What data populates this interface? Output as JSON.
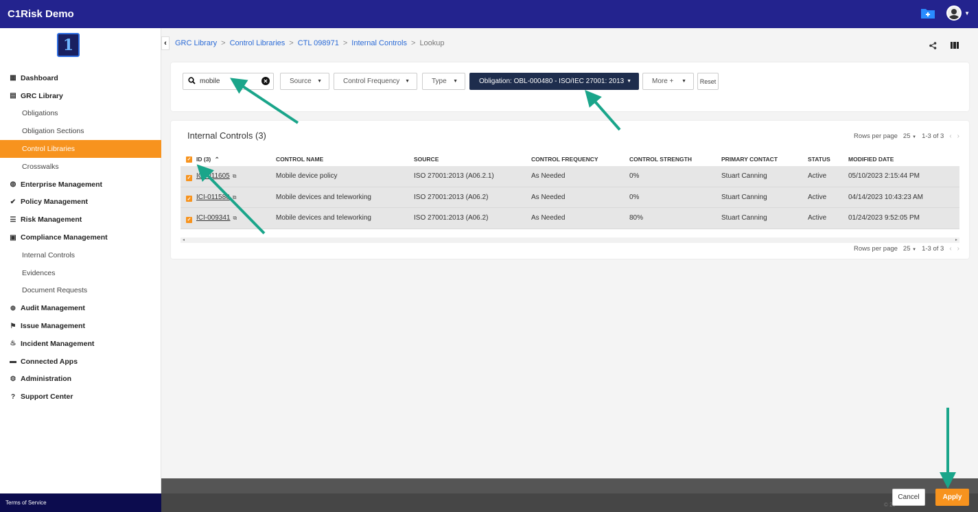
{
  "app": {
    "title": "C1Risk Demo",
    "logo_glyph": "1"
  },
  "colors": {
    "topbar": "#23238e",
    "accent": "#f7931e",
    "dark_filter": "#1e2d4d",
    "arrow": "#1aa58a"
  },
  "sidebar": {
    "items": [
      {
        "label": "Dashboard",
        "icon": "dashboard-icon",
        "level": "top"
      },
      {
        "label": "GRC Library",
        "icon": "book-icon",
        "level": "top"
      },
      {
        "label": "Obligations",
        "level": "sub"
      },
      {
        "label": "Obligation Sections",
        "level": "sub"
      },
      {
        "label": "Control Libraries",
        "level": "sub",
        "active": true
      },
      {
        "label": "Crosswalks",
        "level": "sub"
      },
      {
        "label": "Enterprise Management",
        "icon": "globe-icon",
        "level": "top"
      },
      {
        "label": "Policy Management",
        "icon": "check-icon",
        "level": "top"
      },
      {
        "label": "Risk Management",
        "icon": "list-icon",
        "level": "top"
      },
      {
        "label": "Compliance Management",
        "icon": "clipboard-icon",
        "level": "top"
      },
      {
        "label": "Internal Controls",
        "level": "sub"
      },
      {
        "label": "Evidences",
        "level": "sub"
      },
      {
        "label": "Document Requests",
        "level": "sub"
      },
      {
        "label": "Audit Management",
        "icon": "crosshair-icon",
        "level": "top"
      },
      {
        "label": "Issue Management",
        "icon": "flag-icon",
        "level": "top"
      },
      {
        "label": "Incident Management",
        "icon": "fire-icon",
        "level": "top"
      },
      {
        "label": "Connected Apps",
        "icon": "apps-icon",
        "level": "top"
      },
      {
        "label": "Administration",
        "icon": "gear-icon",
        "level": "top"
      },
      {
        "label": "Support Center",
        "icon": "help-icon",
        "level": "top"
      }
    ],
    "footer": "Terms of Service"
  },
  "breadcrumb": {
    "items": [
      "GRC Library",
      "Control Libraries",
      "CTL 098971",
      "Internal Controls"
    ],
    "separator": ">",
    "current": "Lookup"
  },
  "filters": {
    "search_value": "mobile",
    "source": "Source",
    "control_frequency": "Control Frequency",
    "type": "Type",
    "obligation": "Obligation: OBL-000480 - ISO/IEC 27001: 2013",
    "more": "More +",
    "reset": "Reset"
  },
  "table": {
    "title": "Internal Controls (3)",
    "rows_per_page_label": "Rows per page",
    "rows_per_page": "25",
    "range": "1-3 of 3",
    "headers": [
      "ID (3)",
      "CONTROL NAME",
      "SOURCE",
      "CONTROL FREQUENCY",
      "CONTROL STRENGTH",
      "PRIMARY CONTACT",
      "STATUS",
      "MODIFIED DATE"
    ],
    "rows": [
      {
        "id": "ICI-011605",
        "name": "Mobile device policy",
        "source": "ISO 27001:2013 (A06.2.1)",
        "frequency": "As Needed",
        "strength": "0%",
        "contact": "Stuart Canning",
        "status": "Active",
        "modified": "05/10/2023 2:15:44 PM"
      },
      {
        "id": "ICI-011580",
        "name": "Mobile devices and teleworking",
        "source": "ISO 27001:2013 (A06.2)",
        "frequency": "As Needed",
        "strength": "0%",
        "contact": "Stuart Canning",
        "status": "Active",
        "modified": "04/14/2023 10:43:23 AM"
      },
      {
        "id": "ICI-009341",
        "name": "Mobile devices and teleworking",
        "source": "ISO 27001:2013 (A06.2)",
        "frequency": "As Needed",
        "strength": "80%",
        "contact": "Stuart Canning",
        "status": "Active",
        "modified": "01/24/2023 9:52:05 PM"
      }
    ]
  },
  "footer": {
    "cancel": "Cancel",
    "apply": "Apply",
    "copyright": "© 20"
  }
}
